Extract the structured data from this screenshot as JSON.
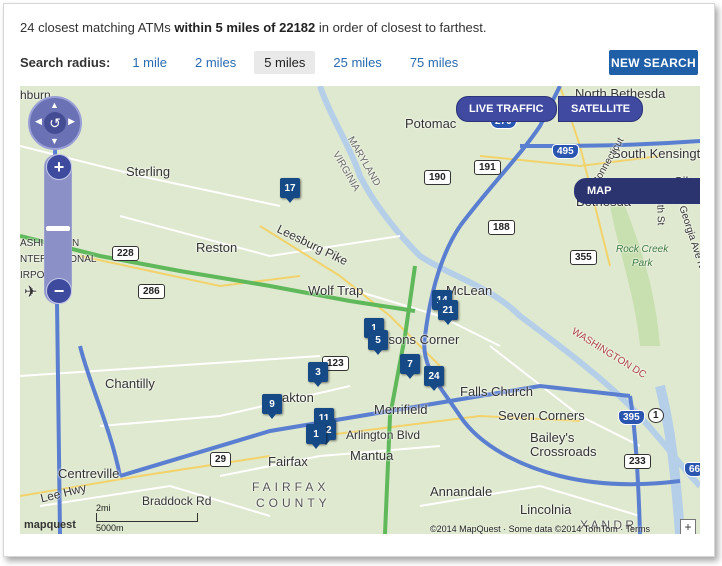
{
  "summary": {
    "prefix": "24 closest matching ATMs ",
    "bold": "within 5 miles of 22182",
    "suffix": " in order of closest to farthest."
  },
  "radius": {
    "label": "Search radius:",
    "options": [
      "1 mile",
      "2 miles",
      "5 miles",
      "25 miles",
      "75 miles"
    ],
    "selected": "5 miles"
  },
  "new_search_label": "NEW SEARCH",
  "map": {
    "toggles": {
      "live_traffic": "LIVE TRAFFIC",
      "map": "MAP",
      "satellite": "SATELLITE",
      "active": "MAP"
    },
    "zoom": {
      "in": "+",
      "out": "−",
      "pan_center": "↺"
    },
    "places": {
      "ashburn": "hburn",
      "sterling": "Sterling",
      "potomac": "Potomac",
      "north_bethesda": "North Bethesda",
      "south_kensington": "South Kensingto",
      "bethesda": "Bethesda",
      "silver": "Silve",
      "reston": "Reston",
      "wolf_trap": "Wolf Trap",
      "mclean": "McLean",
      "tysons": "ysons Corner",
      "chantilly": "Chantilly",
      "oakton": "akton",
      "merrifield": "Merrifield",
      "falls_church": "Falls Church",
      "seven_corners": "Seven Corners",
      "baileys": "Bailey's",
      "crossroads": "Crossroads",
      "arlington_blvd": "Arlington Blvd",
      "fairfax": "Fairfax",
      "mantua": "Mantua",
      "centreville": "Centreville",
      "annandale": "Annandale",
      "lincolnia": "Lincolnia",
      "fairfax_county_1": "FAIRFAX",
      "fairfax_county_2": "COUNTY",
      "leesburg_pike": "Leesburg Pike",
      "lee_hwy": "Lee Hwy",
      "braddock": "Braddock Rd",
      "airport_1": "ASHINGTON",
      "airport_2": "NTERNATIONAL",
      "airport_3": "IRPORT",
      "rock_creek_1": "Rock Creek",
      "rock_creek_2": "Park",
      "maryland": "MARYLAND",
      "virginia": "VIRGINIA",
      "washington": "WASHINGTON DC",
      "georgia_ave": "Georgia Ave NW",
      "sixteenth": "16th St",
      "connecticut": "Connecticut",
      "alexandria": "X A N D R"
    },
    "shields": [
      "228",
      "286",
      "190",
      "191",
      "188",
      "355",
      "29",
      "233",
      "123"
    ],
    "interstates": [
      "270",
      "495",
      "395",
      "66"
    ],
    "us_routes": [
      "1"
    ],
    "markers": [
      "17",
      "14",
      "21",
      "1",
      "5",
      "7",
      "24",
      "3",
      "9",
      "11",
      "12",
      "1"
    ],
    "scale": {
      "miles": "2mi",
      "meters": "5000m"
    },
    "logo": "mapquest",
    "copyright": "©2014 MapQuest · Some data ©2014 TomTom · Terms",
    "expand": "+"
  },
  "colors": {
    "accent": "#1e5fa8",
    "marker": "#164a86",
    "map_land": "#dfe9cf",
    "highway_green": "#5fb85a",
    "highway_blue": "#5b7fd0",
    "water": "#b6cfe8"
  }
}
